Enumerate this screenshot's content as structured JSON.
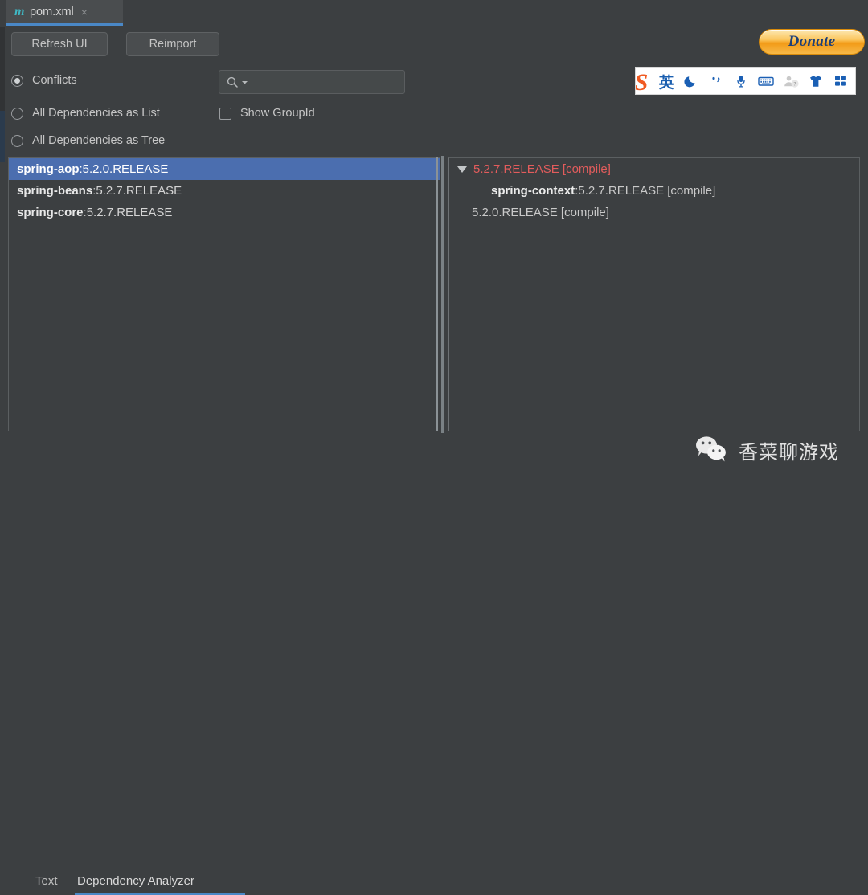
{
  "window": {
    "tab": {
      "icon": "maven-m-icon",
      "title": "pom.xml",
      "close": "×"
    }
  },
  "toolbar": {
    "refresh_label": "Refresh UI",
    "reimport_label": "Reimport"
  },
  "filters": {
    "options": [
      {
        "label": "Conflicts",
        "selected": true
      },
      {
        "label": "All Dependencies as List",
        "selected": false
      },
      {
        "label": "All Dependencies as Tree",
        "selected": false
      }
    ],
    "checkbox": {
      "label": "Show GroupId",
      "checked": false
    }
  },
  "search": {
    "placeholder": "",
    "value": "",
    "icon": "search-icon",
    "dropdown_icon": "chevron-down-icon"
  },
  "dependency_list": {
    "rows": [
      {
        "artifact": "spring-aop",
        "separator": " : ",
        "version": "5.2.0.RELEASE",
        "selected": true
      },
      {
        "artifact": "spring-beans",
        "separator": " : ",
        "version": "5.2.7.RELEASE",
        "selected": false
      },
      {
        "artifact": "spring-core",
        "separator": " : ",
        "version": "5.2.7.RELEASE",
        "selected": false
      }
    ]
  },
  "dependency_tree": {
    "rows": [
      {
        "expander": "triangle-down-icon",
        "text": "5.2.7.RELEASE [compile]",
        "conflict": true
      },
      {
        "artifact": "spring-context",
        "separator": " : ",
        "text": "5.2.7.RELEASE [compile]",
        "conflict": false
      },
      {
        "text": "5.2.0.RELEASE [compile]",
        "conflict": false
      }
    ]
  },
  "bottom_tabs": [
    {
      "label": "Text",
      "active": false
    },
    {
      "label": "Dependency Analyzer",
      "active": true
    }
  ],
  "donate": {
    "label": "Donate"
  },
  "ime": {
    "logo": "S",
    "items": [
      {
        "name": "input-mode-english",
        "glyph": "英"
      },
      {
        "name": "night-mode-icon",
        "glyph": "moon"
      },
      {
        "name": "punctuation-icon",
        "glyph": "punct"
      },
      {
        "name": "voice-input-icon",
        "glyph": "mic"
      },
      {
        "name": "soft-keyboard-icon",
        "glyph": "keyboard"
      },
      {
        "name": "user-account-icon",
        "glyph": "person"
      },
      {
        "name": "skin-theme-icon",
        "glyph": "shirt"
      },
      {
        "name": "app-grid-icon",
        "glyph": "grid"
      }
    ]
  },
  "watermark": {
    "icon": "wechat-icon",
    "text": "香菜聊游戏"
  },
  "colors": {
    "panel_bg": "#3c3f41",
    "selection_blue": "#4b6eaf",
    "accent_blue": "#4a88c7",
    "conflict_red": "#e25c5c",
    "maven_teal": "#3fb8c4",
    "donate_orange": "#f29b17",
    "ime_blue": "#1a5fb4",
    "sogou_orange": "#f05a22"
  }
}
